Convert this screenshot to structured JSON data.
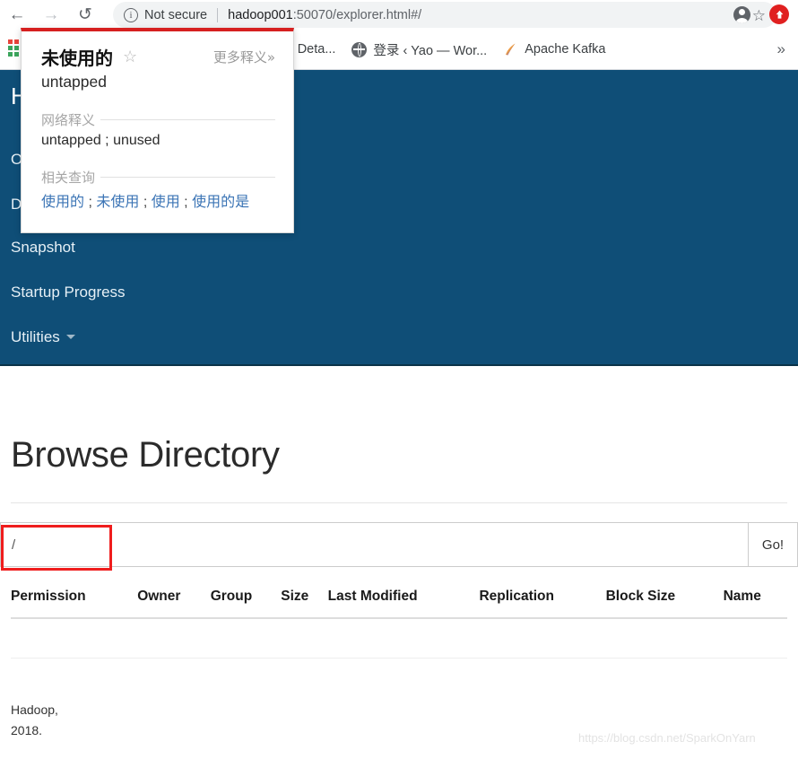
{
  "browser": {
    "back_icon": "back-arrow-icon",
    "forward_icon": "forward-arrow-icon",
    "reload_icon": "reload-icon",
    "security_label": "Not secure",
    "info_glyph": "ⓘ",
    "url_host": "hadoop001",
    "url_rest": ":50070/explorer.html#/",
    "bookmark_star": "☆",
    "overflow_glyph": "»"
  },
  "bookmarks": {
    "apps_grid_colors": [
      "#e8453c",
      "#e8453c",
      "#e8453c",
      "#3ba55c",
      "#3ba55c",
      "#f5b400",
      "#3ba55c",
      "#3ba55c",
      "#f5b400"
    ],
    "items": [
      {
        "label": "shell - Deta...",
        "icon": "none-favicon"
      },
      {
        "label": "登录 ‹ Yao — Wor...",
        "icon": "globe-favicon"
      },
      {
        "label": "Apache Kafka",
        "icon": "feather-favicon"
      }
    ],
    "overflow": "»"
  },
  "hadoop_nav": {
    "brand": "H",
    "items": [
      {
        "label": "O",
        "name": "overview"
      },
      {
        "label": "D",
        "name": "datanodes"
      },
      {
        "label": "Snapshot",
        "name": "snapshot"
      },
      {
        "label": "Startup Progress",
        "name": "startup-progress"
      },
      {
        "label": "Utilities",
        "name": "utilities",
        "has_caret": true
      }
    ],
    "background": "#0F4E77"
  },
  "main": {
    "title": "Browse Directory",
    "path_value": "/",
    "path_placeholder": "",
    "go_label": "Go!",
    "table_headers": [
      "Permission",
      "Owner",
      "Group",
      "Size",
      "Last Modified",
      "Replication",
      "Block Size",
      "Name"
    ],
    "rows": [],
    "footer_line1": "Hadoop,",
    "footer_line2": "2018.",
    "watermark": "https://blog.csdn.net/SparkOnYarn",
    "annotation_color": "#ef1d1d"
  },
  "dictionary_popup": {
    "word": "未使用的",
    "star_glyph": "☆",
    "more_label": "更多释义»",
    "translation": "untapped",
    "section_web_label": "网络释义",
    "web_meanings": "untapped ; unused",
    "section_related_label": "相关查询",
    "related_queries": [
      "使用的",
      "未使用",
      "使用",
      "使用的是"
    ],
    "related_separator": " ; ",
    "accent_color": "#d62020"
  }
}
